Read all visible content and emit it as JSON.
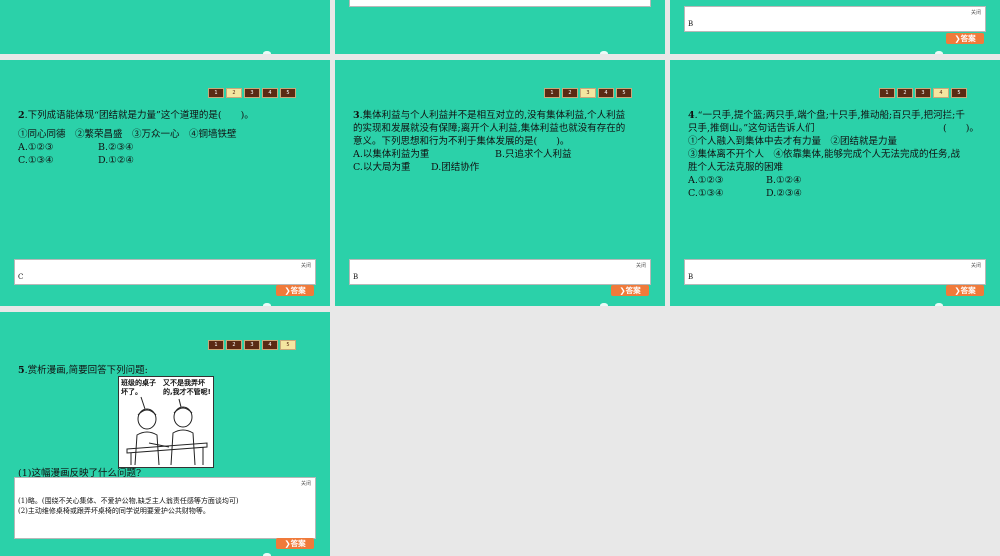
{
  "nav_labels": [
    "1",
    "2",
    "3",
    "4",
    "5"
  ],
  "close_label": "关闭",
  "answer_button": "答案",
  "top_slides": {
    "left_answer": "",
    "right_answer": "B"
  },
  "q2": {
    "num": "2",
    "stem": ".下列成语能体现“团结就是力量”这个道理的是(　　)。",
    "opts_line1": "①同心同德　②繁荣昌盛　③万众一心　④铜墙铁壁",
    "optA": "A.①②③",
    "optB": "B.②③④",
    "optC": "C.①③④",
    "optD": "D.①②④",
    "answer": "C"
  },
  "q3": {
    "num": "3",
    "line1": ".集体利益与个人利益并不是相互对立的,没有集体利益,个人利益",
    "line2": "的实现和发展就没有保障;离开个人利益,集体利益也就没有存在的",
    "line3": "意义。下列思想和行为不利于集体发展的是(　　)。",
    "optA": "A.以集体利益为重",
    "optB": "B.只追求个人利益",
    "optC": "C.以大局为重",
    "optD": "D.团结协作",
    "answer": "B"
  },
  "q4": {
    "num": "4",
    "line1": ".“一只手,提个篮;两只手,端个盘;十只手,推动船;百只手,把河拦;千",
    "line2": "只手,推倒山。”这句话告诉人们",
    "paren": "(　　)。",
    "line3": "①个人融入到集体中去才有力量　②团结就是力量",
    "line4": "③集体离不开个人　④依靠集体,能够完成个人无法完成的任务,战",
    "line5": "胜个人无法克服的困难",
    "optA": "A.①②③",
    "optB": "B.①②④",
    "optC": "C.①③④",
    "optD": "D.②③④",
    "answer": "B"
  },
  "q5": {
    "num": "5",
    "stem": ".赏析漫画,简要回答下列问题:",
    "bubble_left": "班级的桌子坏了。",
    "bubble_right": "又不是我弄坏的,我才不管呢!",
    "sub1": "(1)这幅漫画反映了什么问题?",
    "ans1": "(1)略。(围绕不关心集体、不爱护公物,缺乏主人翁责任感等方面谈均可)",
    "ans2": "(2)主动维修桌椅或跟弄坏桌椅的同学说明要爱护公共财物等。"
  }
}
